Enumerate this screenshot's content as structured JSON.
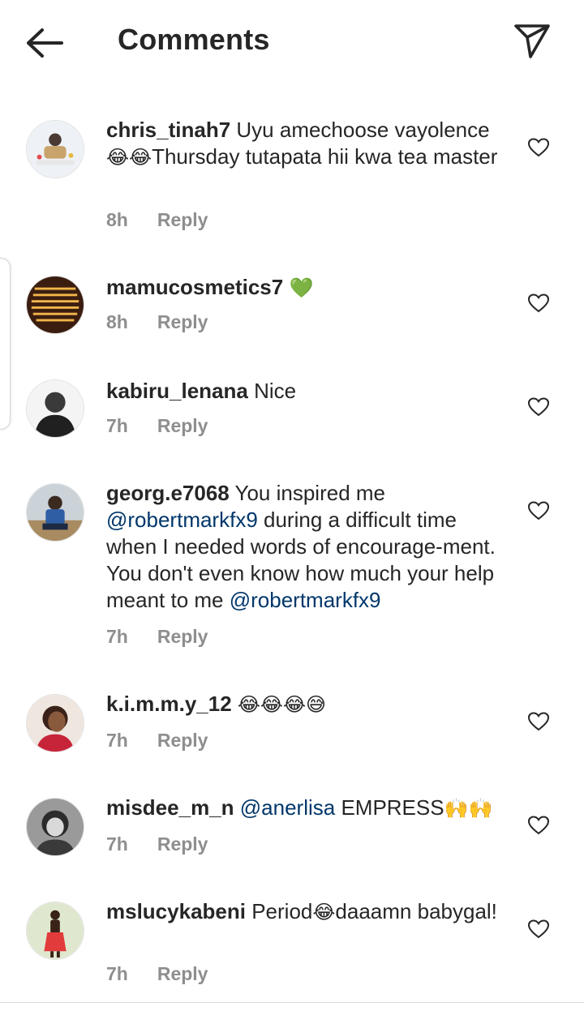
{
  "header": {
    "title": "Comments"
  },
  "reply_label": "Reply",
  "comments": [
    {
      "username": "chris_tinah7",
      "text": " Uyu amechoose vayolence ",
      "emoji": "😂😂",
      "text2": "Thursday tutapata hii kwa tea master",
      "time": "8h"
    },
    {
      "username": "mamucosmetics7",
      "text": " ",
      "emoji": "💚",
      "time": "8h"
    },
    {
      "username": "kabiru_lenana",
      "text": " Nice",
      "time": "7h"
    },
    {
      "username": "georg.e7068",
      "text": " You inspired me ",
      "mention1": "@robertmarkfx9",
      "text2": " during a difficult time when I needed words of encourage-ment. You don't even know how much your help meant to me ",
      "mention2": "@robertmarkfx9",
      "time": "7h"
    },
    {
      "username": "k.i.m.m.y_12",
      "text": " ",
      "emoji": "😂😂😂😅",
      "time": "7h"
    },
    {
      "username": "misdee_m_n",
      "text": " ",
      "mention1": "@anerlisa",
      "text2": " EMPRESS",
      "emoji": "🙌🙌",
      "time": "7h"
    },
    {
      "username": "mslucykabeni",
      "text": " Period",
      "emoji": "😂",
      "text2": "daaamn babygal!",
      "time": "7h"
    }
  ],
  "colors": {
    "text": "#262626",
    "meta": "#8e8e8e",
    "mention": "#00376b"
  }
}
